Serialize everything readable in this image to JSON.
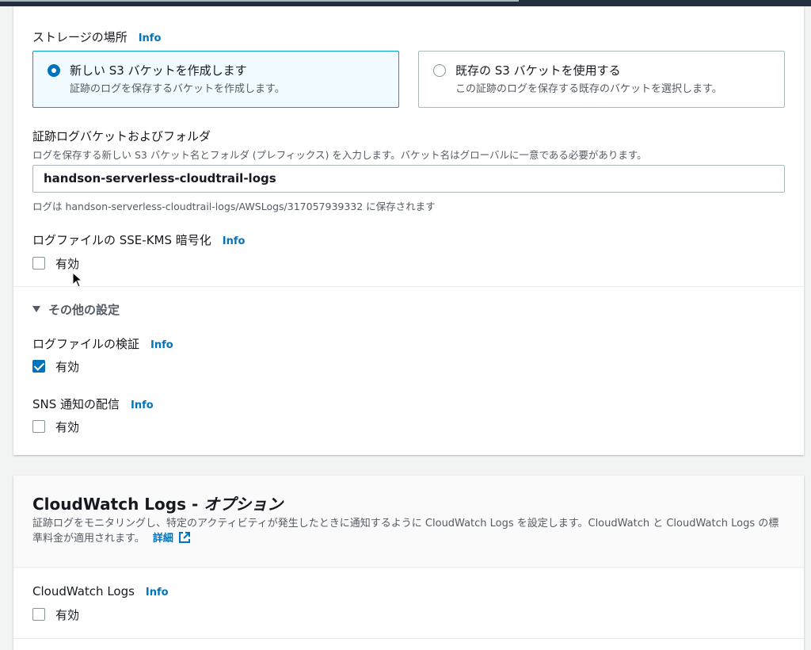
{
  "storage": {
    "label": "ストレージの場所",
    "info": "Info",
    "options": [
      {
        "title": "新しい S3 バケットを作成します",
        "desc": "証跡のログを保存するバケットを作成します。",
        "selected": true
      },
      {
        "title": "既存の S3 バケットを使用する",
        "desc": "この証跡のログを保存する既存のバケットを選択します。",
        "selected": false
      }
    ]
  },
  "bucket": {
    "label": "証跡ログバケットおよびフォルダ",
    "desc": "ログを保存する新しい S3 バケット名とフォルダ (プレフィックス) を入力します。バケット名はグローバルに一意である必要があります。",
    "value": "handson-serverless-cloudtrail-logs",
    "hint": "ログは handson-serverless-cloudtrail-logs/AWSLogs/317057939332 に保存されます"
  },
  "sse_kms": {
    "label": "ログファイルの SSE-KMS 暗号化",
    "info": "Info",
    "checkbox_label": "有効",
    "checked": false
  },
  "other_settings": {
    "label": "その他の設定"
  },
  "validation": {
    "label": "ログファイルの検証",
    "info": "Info",
    "checkbox_label": "有効",
    "checked": true
  },
  "sns": {
    "label": "SNS 通知の配信",
    "info": "Info",
    "checkbox_label": "有効",
    "checked": false
  },
  "cloudwatch_section": {
    "title": "CloudWatch Logs - ",
    "title_italic": "オプション",
    "desc": "証跡ログをモニタリングし、特定のアクティビティが発生したときに通知するように CloudWatch Logs を設定します。CloudWatch と CloudWatch Logs の標準料金が適用されます。",
    "link": "詳細"
  },
  "cloudwatch": {
    "label": "CloudWatch Logs",
    "info": "Info",
    "checkbox_label": "有効",
    "checked": false
  },
  "colors": {
    "accent": "#0073bb",
    "selected_border": "#00a1c9",
    "selected_bg": "#f1faff"
  }
}
